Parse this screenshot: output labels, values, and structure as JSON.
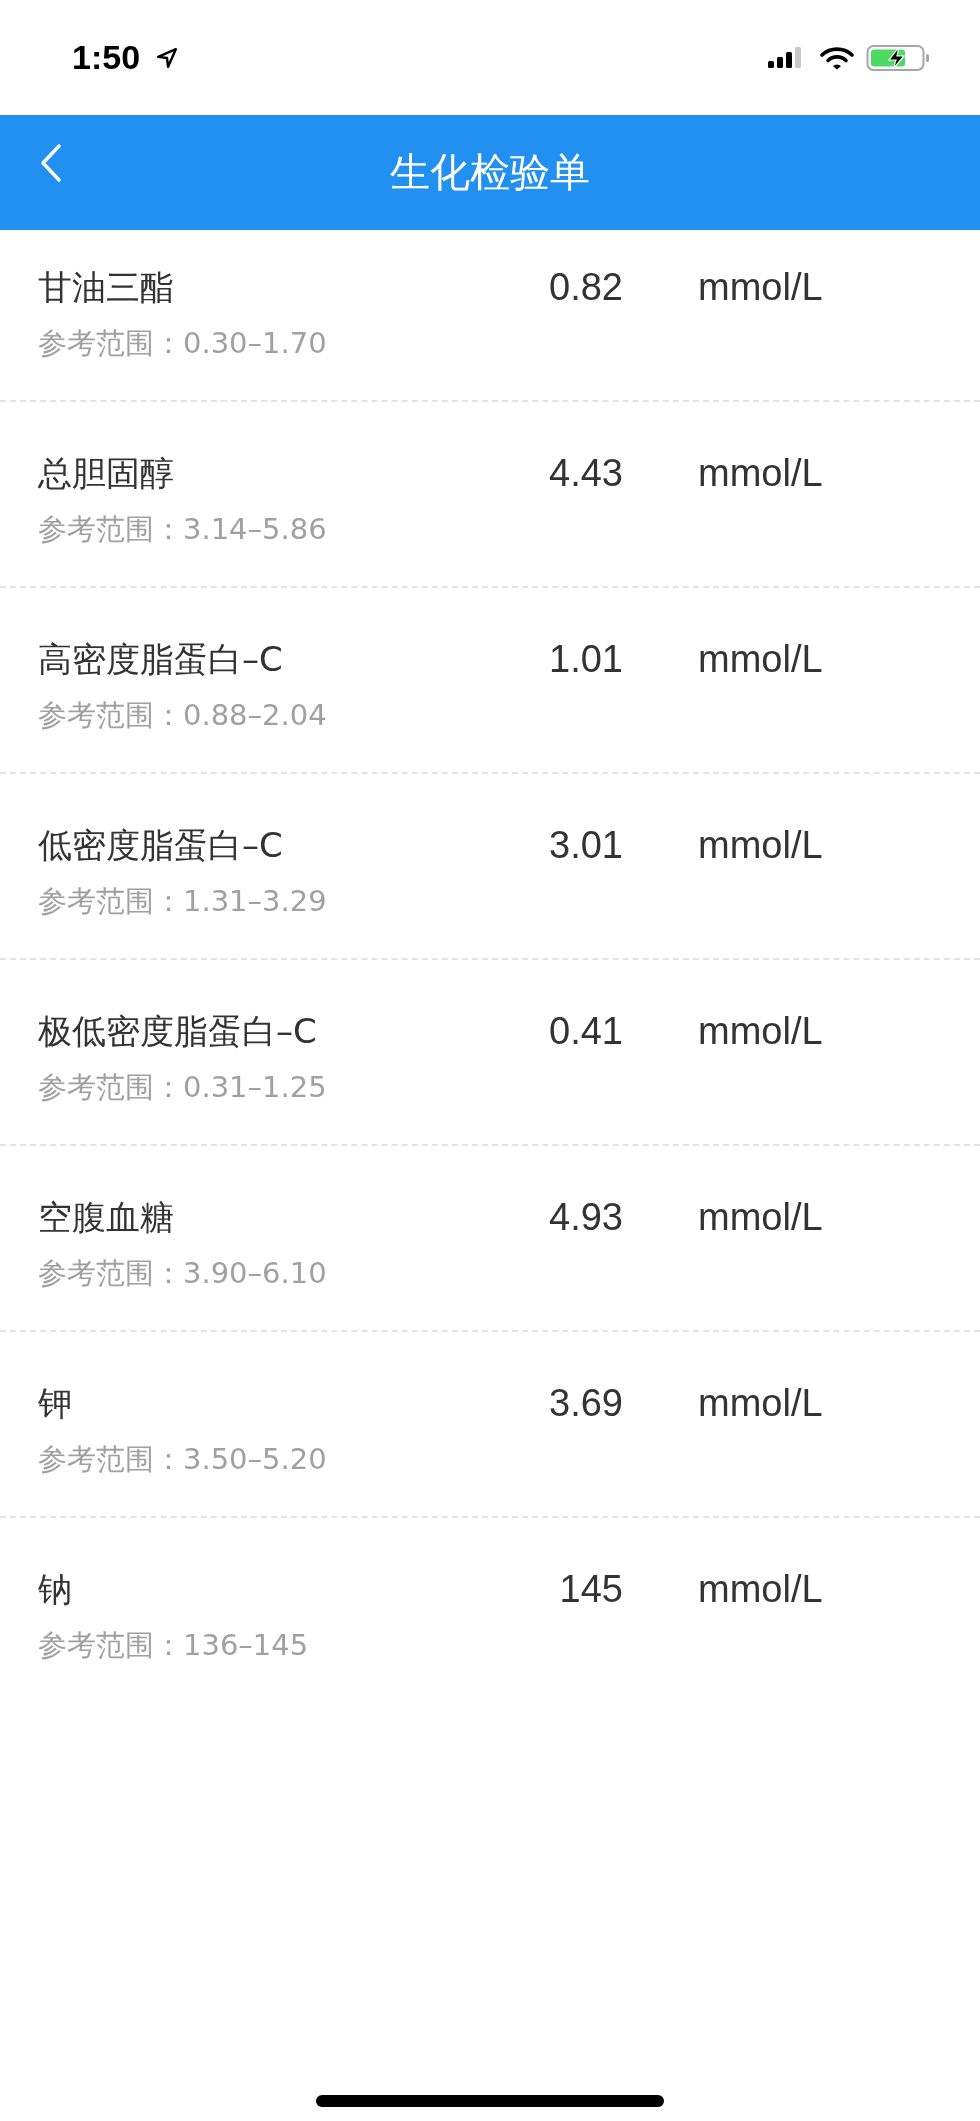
{
  "status_bar": {
    "time": "1:50"
  },
  "nav": {
    "title": "生化检验单"
  },
  "results": [
    {
      "name": "甘油三酯",
      "value": "0.82",
      "unit": "mmol/L",
      "range": "参考范围：0.30–1.70"
    },
    {
      "name": "总胆固醇",
      "value": "4.43",
      "unit": "mmol/L",
      "range": "参考范围：3.14–5.86"
    },
    {
      "name": "高密度脂蛋白–C",
      "value": "1.01",
      "unit": "mmol/L",
      "range": "参考范围：0.88–2.04"
    },
    {
      "name": "低密度脂蛋白–C",
      "value": "3.01",
      "unit": "mmol/L",
      "range": "参考范围：1.31–3.29"
    },
    {
      "name": "极低密度脂蛋白–C",
      "value": "0.41",
      "unit": "mmol/L",
      "range": "参考范围：0.31–1.25"
    },
    {
      "name": "空腹血糖",
      "value": "4.93",
      "unit": "mmol/L",
      "range": "参考范围：3.90–6.10"
    },
    {
      "name": "钾",
      "value": "3.69",
      "unit": "mmol/L",
      "range": "参考范围：3.50–5.20"
    },
    {
      "name": "钠",
      "value": "145",
      "unit": "mmol/L",
      "range": "参考范围：136–145"
    }
  ]
}
